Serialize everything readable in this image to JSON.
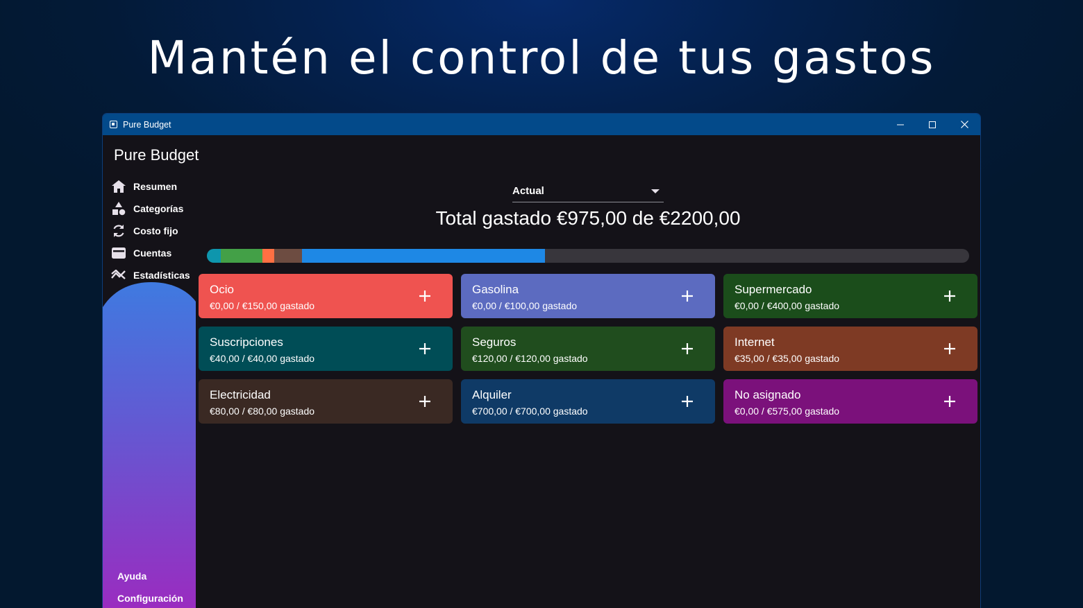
{
  "headline": "Mantén el control de tus gastos",
  "window": {
    "title": "Pure Budget",
    "controls": {
      "minimize": "minimize-icon",
      "maximize": "maximize-icon",
      "close": "close-icon"
    }
  },
  "sidebar": {
    "app_title": "Pure Budget",
    "items": [
      {
        "label": "Resumen",
        "icon": "home-icon"
      },
      {
        "label": "Categorías",
        "icon": "shapes-icon"
      },
      {
        "label": "Costo fijo",
        "icon": "refresh-icon"
      },
      {
        "label": "Cuentas",
        "icon": "wallet-icon"
      },
      {
        "label": "Estadísticas",
        "icon": "chart-icon"
      }
    ],
    "bottom": [
      {
        "label": "Ayuda"
      },
      {
        "label": "Configuración"
      }
    ]
  },
  "main": {
    "period": "Actual",
    "total": "Total gastado €975,00 de €2200,00",
    "progress": {
      "total": 2200,
      "segments": [
        {
          "category": "Suscripciones",
          "value": 40,
          "color": "#0e96ad"
        },
        {
          "category": "Seguros",
          "value": 120,
          "color": "#43a047"
        },
        {
          "category": "Internet",
          "value": 35,
          "color": "#ff7043"
        },
        {
          "category": "Electricidad",
          "value": 80,
          "color": "#6d4c41"
        },
        {
          "category": "Alquiler",
          "value": 700,
          "color": "#1e88e5"
        }
      ],
      "track_color": "#38363c"
    },
    "categories": [
      {
        "name": "Ocio",
        "amount": "€0,00 / €150,00 gastado",
        "color": "#ef5350"
      },
      {
        "name": "Gasolina",
        "amount": "€0,00 / €100,00 gastado",
        "color": "#5c6bc0"
      },
      {
        "name": "Supermercado",
        "amount": "€0,00 / €400,00 gastado",
        "color": "#1b4d1b"
      },
      {
        "name": "Suscripciones",
        "amount": "€40,00 / €40,00 gastado",
        "color": "#004d56"
      },
      {
        "name": "Seguros",
        "amount": "€120,00 / €120,00 gastado",
        "color": "#204d1e"
      },
      {
        "name": "Internet",
        "amount": "€35,00 / €35,00 gastado",
        "color": "#7e3a24"
      },
      {
        "name": "Electricidad",
        "amount": "€80,00 / €80,00 gastado",
        "color": "#3a2923"
      },
      {
        "name": "Alquiler",
        "amount": "€700,00 / €700,00 gastado",
        "color": "#0f3a66"
      },
      {
        "name": "No asignado",
        "amount": "€0,00 / €575,00 gastado",
        "color": "#7b117b"
      }
    ]
  }
}
